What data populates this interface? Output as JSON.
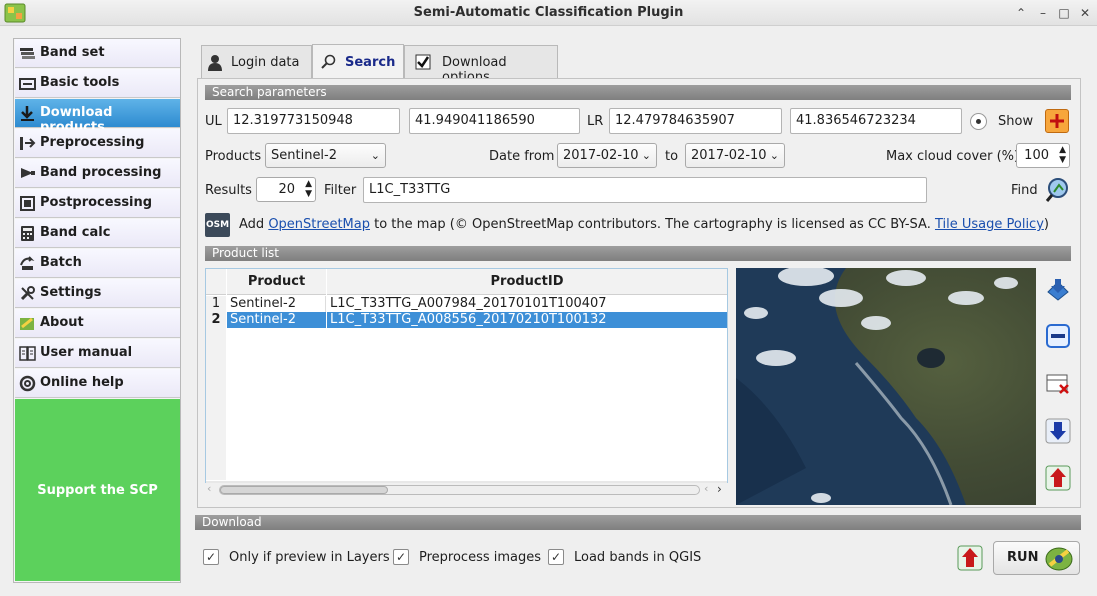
{
  "window": {
    "title": "Semi-Automatic Classification Plugin"
  },
  "sidebar": {
    "items": [
      {
        "label": "Band set",
        "icon": "band-set-icon"
      },
      {
        "label": "Basic tools",
        "icon": "basic-tools-icon"
      },
      {
        "label": "Download products",
        "icon": "download-icon"
      },
      {
        "label": "Preprocessing",
        "icon": "preprocessing-icon"
      },
      {
        "label": "Band processing",
        "icon": "band-processing-icon"
      },
      {
        "label": "Postprocessing",
        "icon": "postprocessing-icon"
      },
      {
        "label": "Band calc",
        "icon": "calculator-icon"
      },
      {
        "label": "Batch",
        "icon": "batch-icon"
      },
      {
        "label": "Settings",
        "icon": "wrench-icon"
      },
      {
        "label": "About",
        "icon": "about-icon"
      },
      {
        "label": "User manual",
        "icon": "manual-icon"
      },
      {
        "label": "Online help",
        "icon": "help-icon"
      }
    ],
    "support_label": "Support the SCP"
  },
  "tabs": [
    {
      "label": "Login data"
    },
    {
      "label": "Search"
    },
    {
      "label": "Download options"
    }
  ],
  "search": {
    "section_label": "Search parameters",
    "ul_label": "UL",
    "ul_x": "12.319773150948",
    "ul_y": "41.949041186590",
    "lr_label": "LR",
    "lr_x": "12.479784635907",
    "lr_y": "41.836546723234",
    "show_label": "Show",
    "products_label": "Products",
    "products_value": "Sentinel-2",
    "date_from_label": "Date from",
    "date_from": "2017-02-10",
    "to_label": "to",
    "date_to": "2017-02-10",
    "cloud_label": "Max cloud cover (%)",
    "cloud_value": "100",
    "results_label": "Results",
    "results_value": "20",
    "filter_label": "Filter",
    "filter_value": "L1C_T33TTG",
    "find_label": "Find",
    "osm_badge": "OSM",
    "osm_text_1": "Add",
    "osm_link": "OpenStreetMap",
    "osm_text_2": "to the map  (© OpenStreetMap contributors. The cartography is licensed as CC BY-SA.",
    "osm_policy": "Tile Usage Policy",
    "osm_text_3": ")"
  },
  "product_list": {
    "section_label": "Product list",
    "columns": [
      "Product",
      "ProductID"
    ],
    "rows": [
      {
        "num": "1",
        "product": "Sentinel-2",
        "id": "L1C_T33TTG_A007984_20170101T100407"
      },
      {
        "num": "2",
        "product": "Sentinel-2",
        "id": "L1C_T33TTG_A008556_20170210T100132"
      }
    ]
  },
  "download": {
    "section_label": "Download",
    "only_preview": "Only if preview in Layers",
    "preprocess": "Preprocess images",
    "load_bands": "Load bands in QGIS",
    "run_label": "RUN"
  },
  "colors": {
    "accent": "#2e8bd0",
    "support": "#5cd15c",
    "section": "#8a8a8a"
  }
}
